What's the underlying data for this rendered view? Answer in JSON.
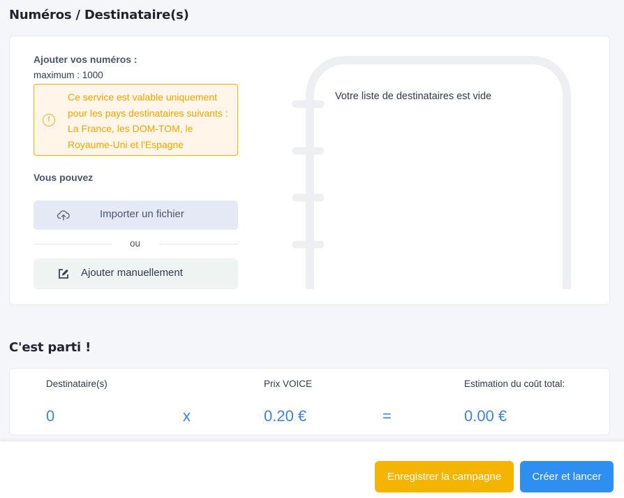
{
  "sections": {
    "numbers_title": "Numéros / Destinataire(s)",
    "summary_title": "C'est parti !"
  },
  "numbers": {
    "add_label": "Ajouter vos numéros :",
    "max_label": "maximum : 1000",
    "warning": "Ce service est valable uniquement pour les pays destinataires suivants : La France, les DOM-TOM, le Royaume-Uni et l'Espagne",
    "you_can": "Vous pouvez",
    "import_label": "Importer un fichier",
    "or_label": "ou",
    "manual_label": "Ajouter manuellement",
    "empty_list": "Votre liste de destinataires est vide"
  },
  "summary": {
    "recipients_label": "Destinataire(s)",
    "recipients_value": "0",
    "times": "x",
    "price_label": "Prix VOICE",
    "price_value": "0.20 €",
    "equals": "=",
    "estimate_label": "Estimation du coût total:",
    "estimate_value": "0.00 €"
  },
  "footer": {
    "save_label": "Enregistrer la campagne",
    "launch_label": "Créer et lancer"
  },
  "colors": {
    "warning": "#f5b400",
    "accent": "#2f8ff0",
    "value": "#3d84d6"
  },
  "icons": [
    "warning-icon",
    "cloud-upload-icon",
    "edit-icon"
  ]
}
